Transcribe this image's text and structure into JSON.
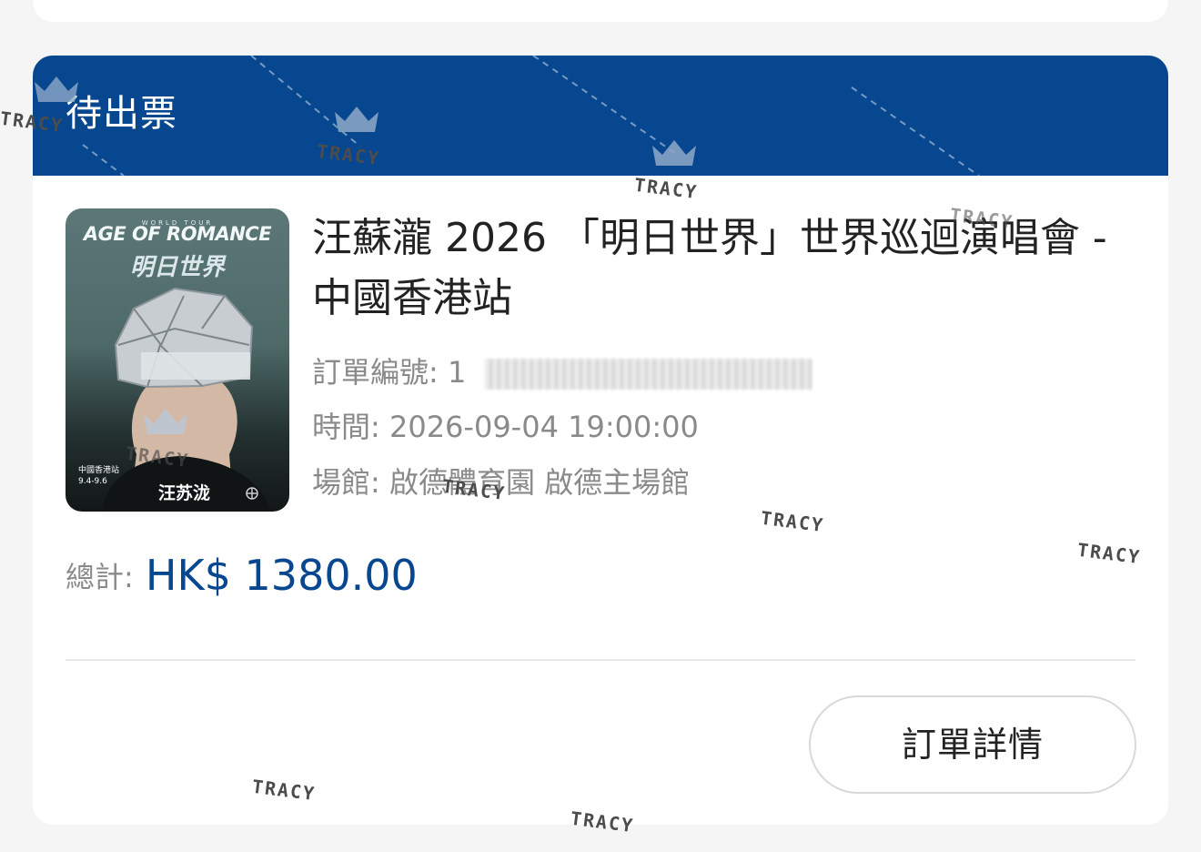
{
  "order": {
    "status": "待出票",
    "poster": {
      "subtitle": "WORLD TOUR",
      "title": "AGE OF ROMANCE",
      "cn_title": "明日世界",
      "info_line1": "中國香港站",
      "info_line2": "9.4-9.6",
      "name": "汪苏泷"
    },
    "event_title": "汪蘇瀧 2026 「明日世界」世界巡迴演唱會 - 中國香港站",
    "order_number_label": "訂單編號:",
    "order_number_value": "1",
    "time_label": "時間:",
    "time_value": "2026-09-04 19:00:00",
    "venue_label": "場館:",
    "venue_value": "啟德體育園 啟德主場館",
    "total_label": "總計:",
    "total_value": "HK$ 1380.00",
    "details_button": "訂單詳情"
  },
  "watermark": {
    "text": "TRACY"
  },
  "colors": {
    "brand_blue": "#07478f",
    "muted_text": "#8a8a8a",
    "title_text": "#222222",
    "divider": "#e6e6e6"
  }
}
